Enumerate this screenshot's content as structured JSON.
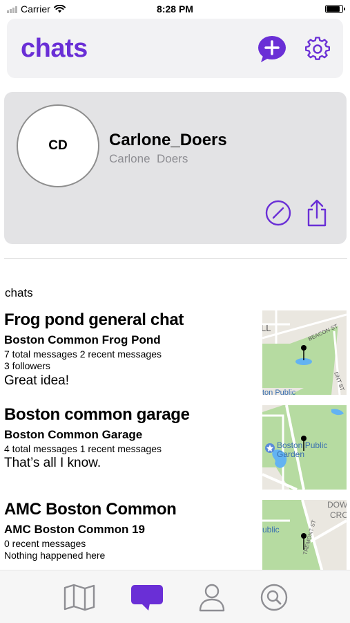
{
  "status_bar": {
    "carrier": "Carrier",
    "time": "8:28 PM",
    "battery_level": 0.95
  },
  "header": {
    "title": "chats",
    "new_chat_icon": "plus-bubble-icon",
    "settings_icon": "gear-icon"
  },
  "profile": {
    "initials": "CD",
    "username": "Carlone_Doers",
    "full_name": "Carlone  Doers",
    "edit_icon": "pencil-circle-icon",
    "share_icon": "share-icon"
  },
  "section_label": "chats",
  "chats": [
    {
      "title": "Frog pond general chat",
      "location": "Boston Common Frog Pond",
      "meta_line1": "7 total messages   2 recent messages",
      "meta_line2": "3 followers",
      "last_message": "Great idea!",
      "map": {
        "labels": [
          "LL",
          "BEACON ST",
          "DNT ST",
          "ton Public"
        ]
      }
    },
    {
      "title": "Boston common garage",
      "location": "Boston Common Garage",
      "meta_line1": "4 total messages   1 recent messages",
      "meta_line2": "",
      "last_message": "That’s all I know.",
      "map": {
        "labels": [
          "Boston Public",
          "Garden"
        ]
      }
    },
    {
      "title": "AMC Boston Common",
      "location": "AMC Boston Common 19",
      "meta_line1": "0 recent messages",
      "meta_line2": "Nothing happened here",
      "last_message": "",
      "map": {
        "labels": [
          "DOW",
          "CRO",
          "TREMONT ST",
          "ublic"
        ]
      }
    }
  ],
  "tab_bar": {
    "tabs": [
      {
        "icon": "map-icon",
        "active": false
      },
      {
        "icon": "chat-bubble-icon",
        "active": true
      },
      {
        "icon": "person-icon",
        "active": false
      },
      {
        "icon": "search-icon",
        "active": false
      }
    ]
  },
  "colors": {
    "accent": "#6a2fd6",
    "card_background": "#e3e3e5",
    "header_background": "#f2f2f4",
    "inactive_tab": "#8e8e93",
    "map_park": "#b6dba1",
    "map_street": "#e9e6df",
    "map_water": "#63b3f2"
  }
}
